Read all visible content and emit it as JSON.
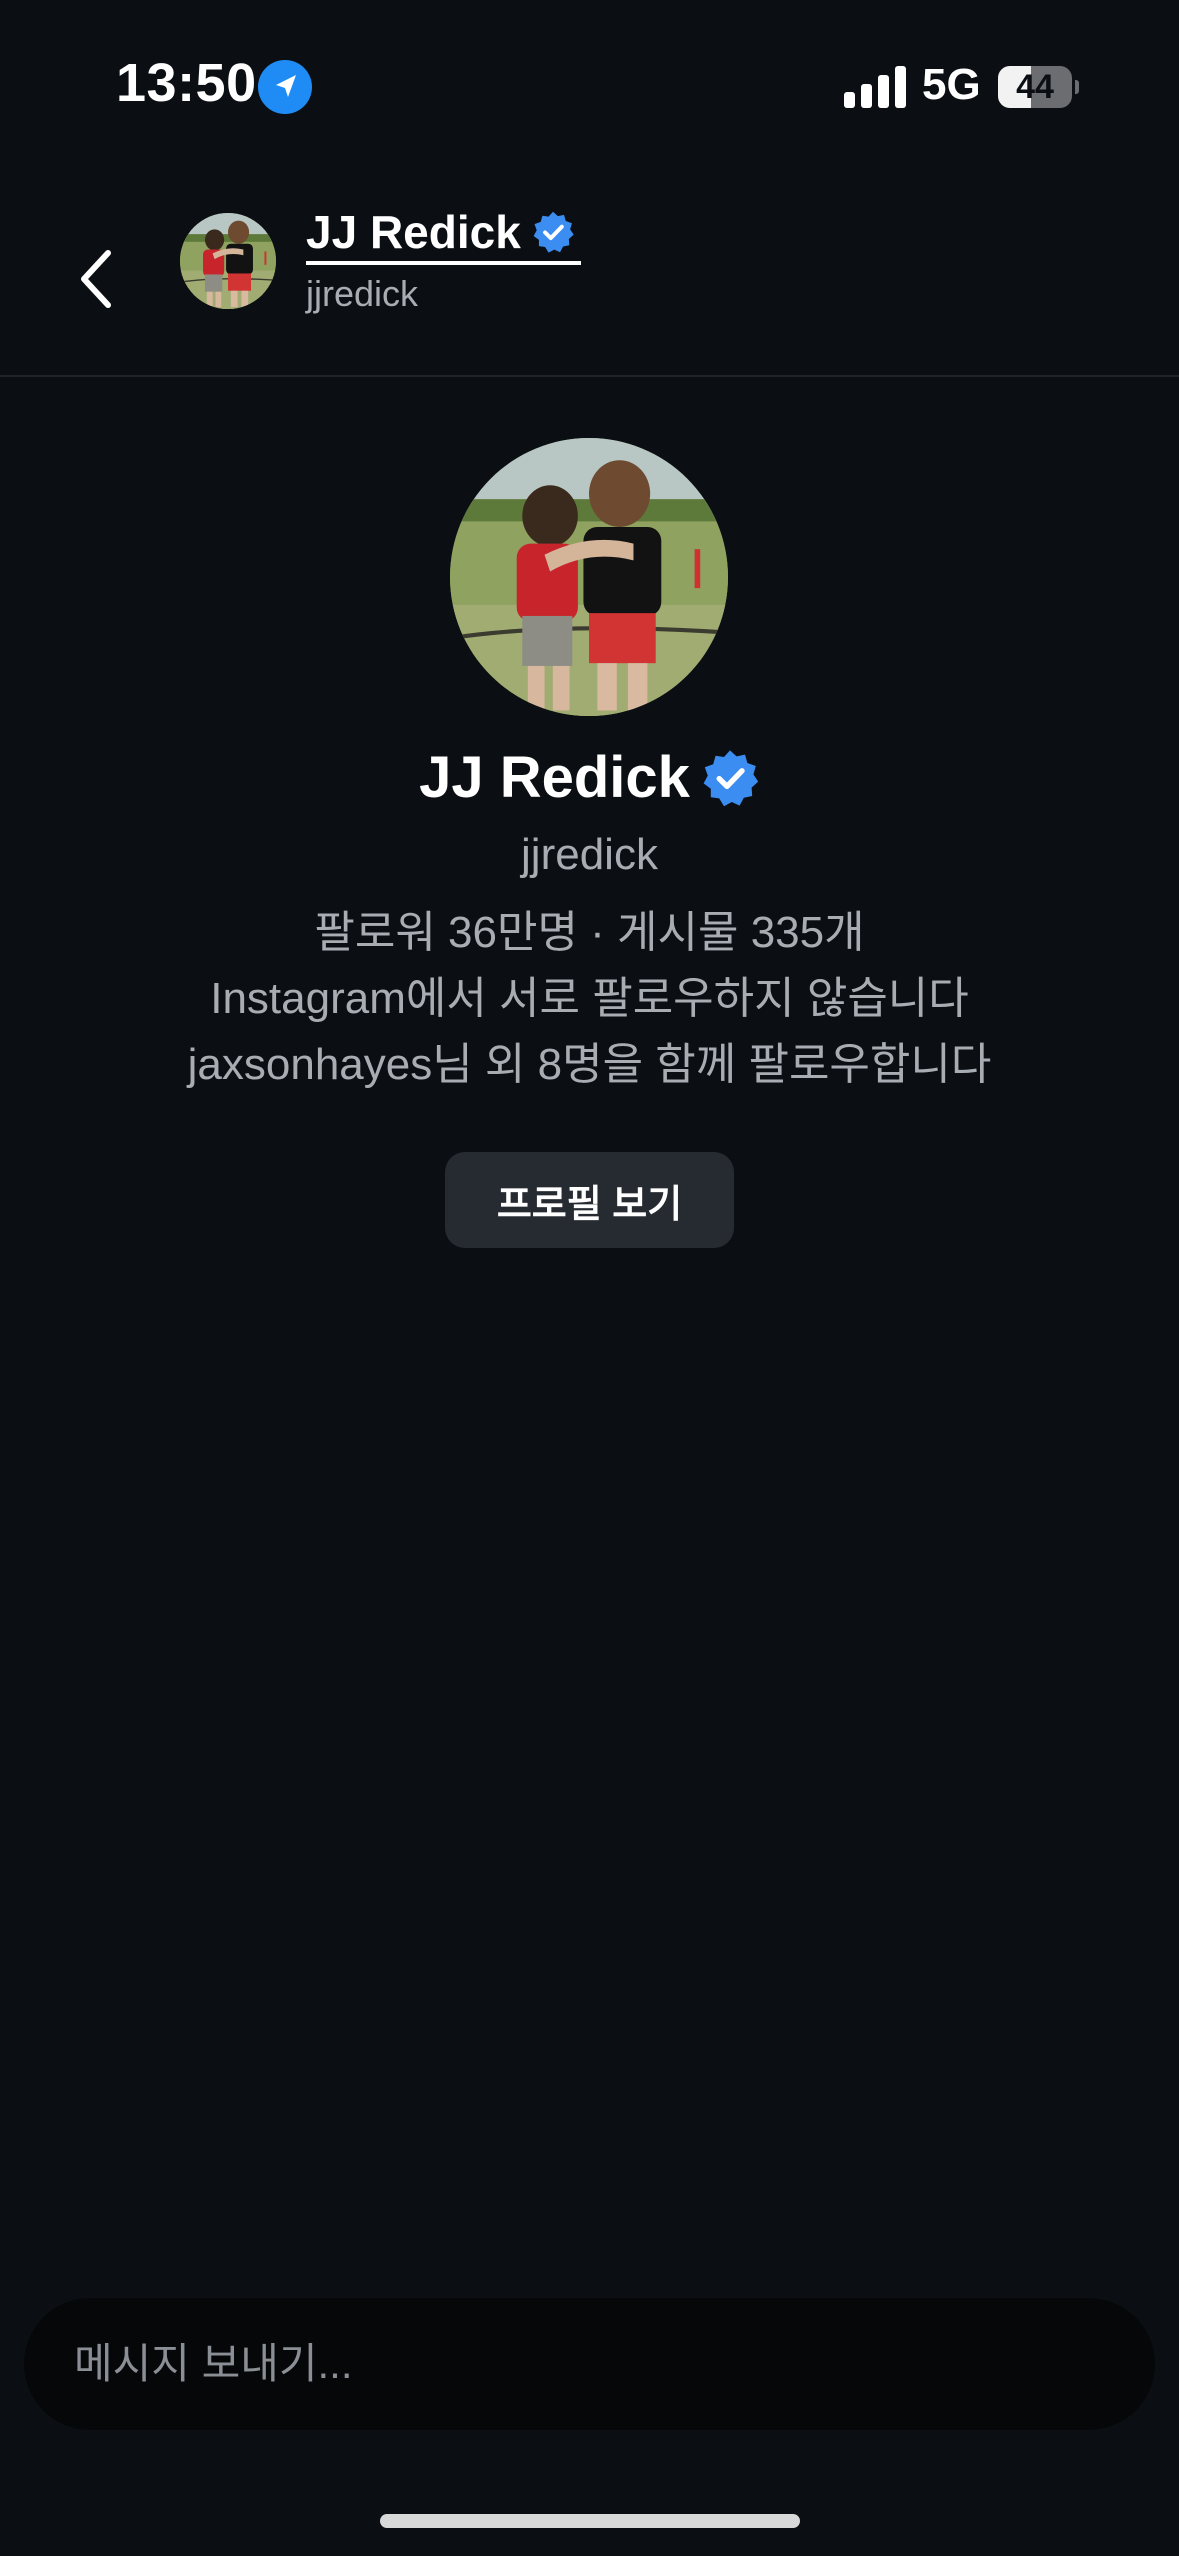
{
  "status_bar": {
    "time": "13:50",
    "network": "5G",
    "battery": "44",
    "battery_level": 0.44,
    "icons": [
      "location-arrow-icon",
      "cellular-signal-icon",
      "battery-icon"
    ]
  },
  "header": {
    "name": "JJ Redick",
    "username": "jjredick",
    "icons": [
      "chevron-left-icon",
      "verified-badge-icon"
    ]
  },
  "profile": {
    "name": "JJ Redick",
    "username": "jjredick",
    "stats": "팔로워 36만명 · 게시물 335개",
    "mutual": "Instagram에서 서로 팔로우하지 않습니다",
    "followed_by": "jaxsonhayes님 외 8명을 함께 팔로우합니다",
    "view_profile_label": "프로필 보기"
  },
  "composer": {
    "placeholder": "메시지 보내기..."
  },
  "colors": {
    "background": "#0b0f14",
    "verified_blue": "#3b8df1",
    "secondary_text": "#a8adb3",
    "button_bg": "#262a31"
  }
}
